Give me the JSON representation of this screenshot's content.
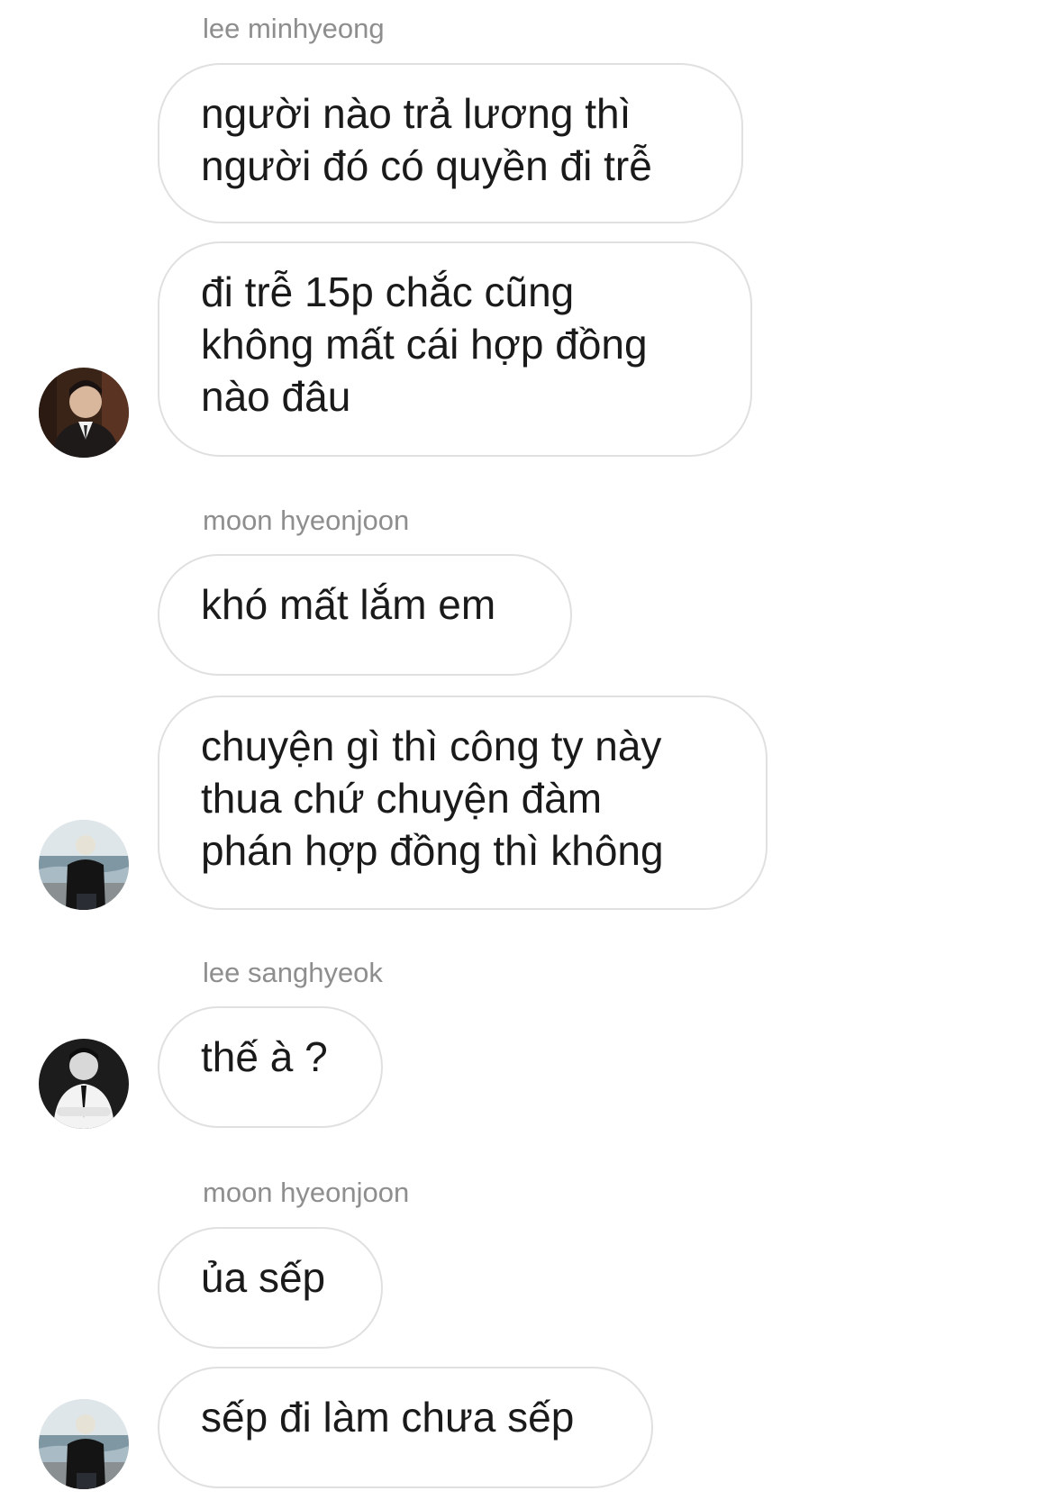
{
  "messages": [
    {
      "sender": "lee minhyeong",
      "bubbles": [
        "người nào trả lương thì\nngười đó có quyền đi trễ",
        "đi trễ 15p chắc cũng\nkhông mất cái hợp đồng\nnào đâu"
      ],
      "avatar": "avatar-suit-man"
    },
    {
      "sender": "moon hyeonjoon",
      "bubbles": [
        "khó mất lắm em",
        "chuyện gì thì công ty này\nthua chứ chuyện đàm\nphán hợp đồng thì không"
      ],
      "avatar": "avatar-beach-back"
    },
    {
      "sender": "lee sanghyeok",
      "bubbles": [
        "thế à ?"
      ],
      "avatar": "avatar-bw-tie"
    },
    {
      "sender": "moon hyeonjoon",
      "bubbles": [
        "ủa sếp",
        "sếp đi làm chưa sếp"
      ],
      "avatar": "avatar-beach-back"
    }
  ]
}
